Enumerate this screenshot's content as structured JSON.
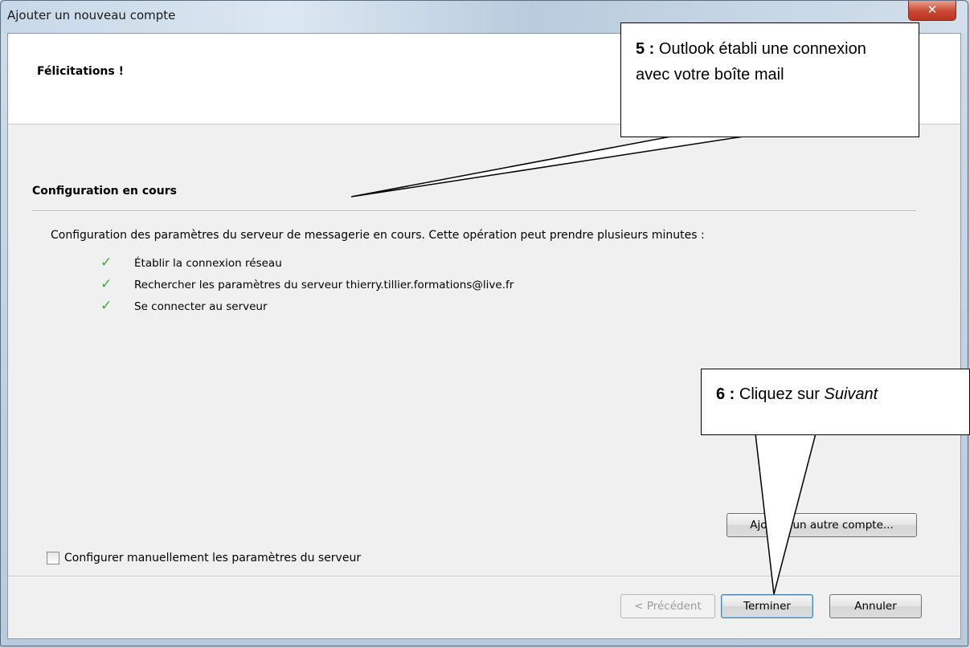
{
  "window": {
    "title": "Ajouter un nouveau compte",
    "close_glyph": "✕"
  },
  "header": {
    "title": "Félicitations !"
  },
  "section": {
    "title": "Configuration en cours",
    "intro": "Configuration des paramètres du serveur de messagerie en cours. Cette opération peut prendre plusieurs minutes :",
    "steps": [
      {
        "icon": "check-icon",
        "glyph": "✓",
        "label": "Établir la connexion réseau"
      },
      {
        "icon": "check-icon",
        "glyph": "✓",
        "label": "Rechercher les paramètres du serveur thierry.tillier.formations@live.fr"
      },
      {
        "icon": "check-icon",
        "glyph": "✓",
        "label": "Se connecter au serveur"
      }
    ]
  },
  "manual_config": {
    "label": "Configurer manuellement les paramètres du serveur",
    "checked": false
  },
  "buttons": {
    "add_account": "Ajouter un autre compte...",
    "previous": "< Précédent",
    "finish": "Terminer",
    "cancel": "Annuler"
  },
  "callouts": {
    "c5_num": "5 :",
    "c5_text": "Outlook établi une connexion avec votre boîte mail",
    "c6_num": "6 :",
    "c6_text": "Cliquez sur ",
    "c6_em": "Suivant"
  },
  "colors": {
    "check": "#3fa83a",
    "close": "#c9462f"
  }
}
